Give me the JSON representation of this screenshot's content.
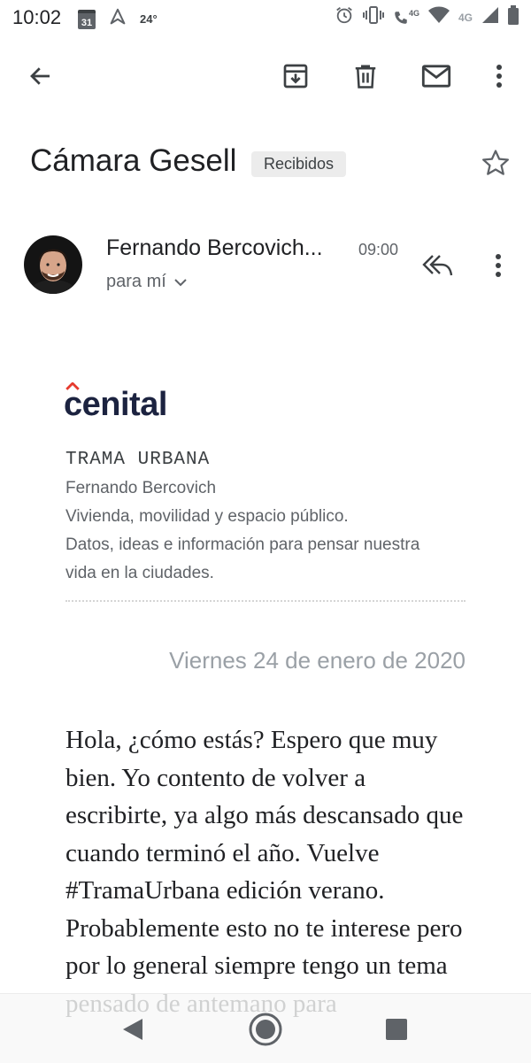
{
  "status_bar": {
    "time": "10:02",
    "calendar_day": "31",
    "temperature": "24°",
    "network_label_small": "4G",
    "network_label": "4G"
  },
  "toolbar": {
    "back": "back-arrow-icon",
    "archive": "archive-icon",
    "delete": "trash-icon",
    "mark_unread": "mail-icon",
    "more": "more-vert-icon"
  },
  "email": {
    "subject": "Cámara Gesell",
    "label": "Recibidos",
    "sender": "Fernando Bercovich...",
    "time": "09:00",
    "recipient": "para mí"
  },
  "newsletter": {
    "brand": "cenital",
    "title": "TRAMA URBANA",
    "author": "Fernando Bercovich",
    "tagline1": "Vivienda, movilidad y espacio público.",
    "tagline2": "Datos, ideas e información para pensar nuestra",
    "tagline3": "vida en la ciudades.",
    "date": "Viernes 24 de enero de 2020",
    "body": "Hola, ¿cómo estás? Espero que muy bien. Yo contento de volver a escribirte, ya algo más descansado que cuando terminó el año. Vuelve #TramaUrbana edición verano. Probablemente esto no te interese pero por lo general siempre tengo un tema pensado de antemano para"
  },
  "colors": {
    "brand_red": "#e63a2e",
    "brand_navy": "#1c2340",
    "icon_gray": "#5f6368"
  }
}
